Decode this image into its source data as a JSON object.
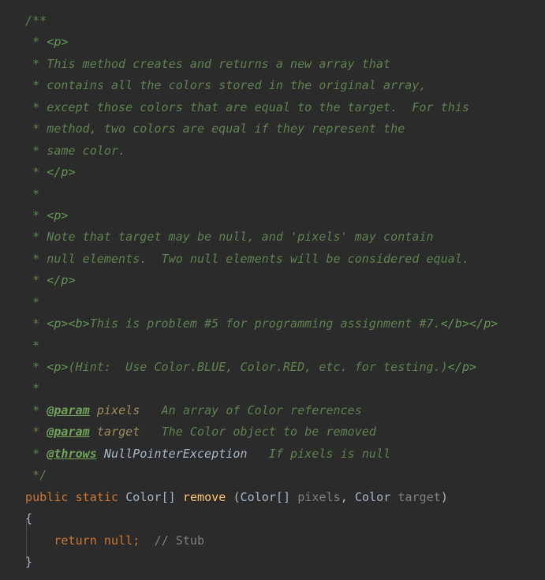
{
  "editor": {
    "background": "#2b2b2b",
    "default_text_color": "#a9b7c6",
    "language": "Java",
    "indent_guide_color": "#4b4b4b"
  },
  "palette": {
    "javadoc_text": "#5f8250",
    "javadoc_markup": "#629755",
    "javadoc_tag": "#72a35a",
    "javadoc_param_name": "#9e8b5e",
    "javadoc_type": "#a9b7c6",
    "keyword": "#cc7832",
    "type": "#a9b7c6",
    "method_name": "#ffc66d",
    "identifier": "#808080",
    "comment": "#808080"
  },
  "code": {
    "lines": [
      {
        "id": "l1",
        "text": "/**"
      },
      {
        "id": "l2",
        "text": " * <p>"
      },
      {
        "id": "l3",
        "text": " * This method creates and returns a new array that"
      },
      {
        "id": "l4",
        "text": " * contains all the colors stored in the original array,"
      },
      {
        "id": "l5",
        "text": " * except those colors that are equal to the target.  For this"
      },
      {
        "id": "l6",
        "text": " * method, two colors are equal if they represent the"
      },
      {
        "id": "l7",
        "text": " * same color."
      },
      {
        "id": "l8",
        "text": " * </p>"
      },
      {
        "id": "l9",
        "text": " *"
      },
      {
        "id": "l10",
        "text": " * <p>"
      },
      {
        "id": "l11",
        "text": " * Note that target may be null, and 'pixels' may contain"
      },
      {
        "id": "l12",
        "text": " * null elements.  Two null elements will be considered equal."
      },
      {
        "id": "l13",
        "text": " * </p>"
      },
      {
        "id": "l14",
        "text": " *"
      },
      {
        "id": "l15",
        "text": " * <p><b>This is problem #5 for programming assignment #7.</b></p>"
      },
      {
        "id": "l16",
        "text": " *"
      },
      {
        "id": "l17",
        "text": " * <p>(Hint:  Use Color.BLUE, Color.RED, etc. for testing.)</p>"
      },
      {
        "id": "l18",
        "text": " *"
      },
      {
        "id": "l19",
        "text": " * @param pixels   An array of Color references"
      },
      {
        "id": "l20",
        "text": " * @param target   The Color object to be removed"
      },
      {
        "id": "l21",
        "text": " * @throws NullPointerException   If pixels is null"
      },
      {
        "id": "l22",
        "text": " */"
      },
      {
        "id": "l23",
        "text": "public static Color[] remove (Color[] pixels, Color target)"
      },
      {
        "id": "l24",
        "text": "{"
      },
      {
        "id": "l25",
        "text": "    return null;  // Stub"
      },
      {
        "id": "l26",
        "text": "}"
      }
    ],
    "tokens": {
      "open_comment": "/**",
      "close_comment": " */",
      "star": " * ",
      "star_only": " *",
      "tag_p_open": "<p>",
      "tag_p_close": "</p>",
      "tag_b_open": "<b>",
      "tag_b_close": "</b>",
      "tag_param": "@param",
      "tag_throws": "@throws",
      "param_pixels": "pixels",
      "param_target": "target",
      "throws_type": "NullPointerException",
      "desc_l3": "This method creates and returns a new array that",
      "desc_l4": "contains all the colors stored in the original array,",
      "desc_l5": "except those colors that are equal to the target.  For this",
      "desc_l6": "method, two colors are equal if they represent the",
      "desc_l7": "same color.",
      "desc_l11": "Note that target may be null, and 'pixels' may contain",
      "desc_l12": "null elements.  Two null elements will be considered equal.",
      "desc_l15": "This is problem #5 for programming assignment #7.",
      "desc_l17": "(Hint:  Use Color.BLUE, Color.RED, etc. for testing.)",
      "desc_param_pixels": "   An array of Color references",
      "desc_param_target": "   The Color object to be removed",
      "desc_throws": "   If pixels is null",
      "kw_public": "public",
      "kw_static": "static",
      "kw_return": "return",
      "kw_null": "null",
      "type_color_array": "Color[]",
      "type_color": "Color",
      "method_remove": "remove",
      "paren_open": " (",
      "paren_close": ")",
      "comma": ", ",
      "semicolon": ";",
      "brace_open": "{",
      "brace_close": "}",
      "indent4": "    ",
      "space": " ",
      "space2": "  ",
      "space3": "   ",
      "comment_stub": "// Stub"
    }
  }
}
